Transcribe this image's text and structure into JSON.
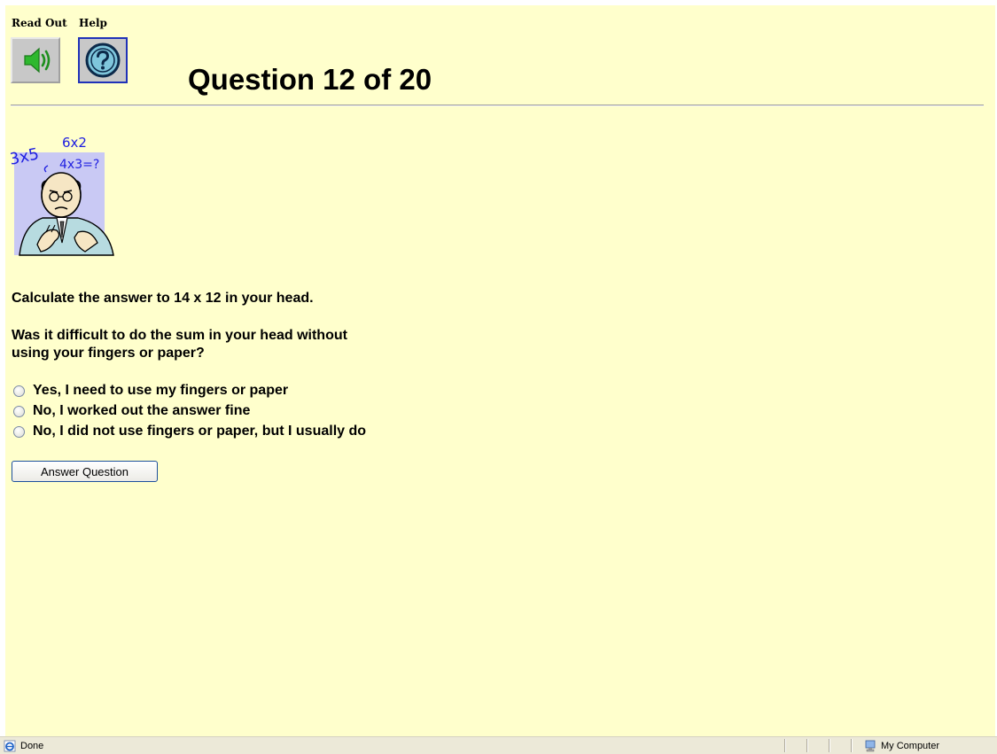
{
  "toolbar": {
    "read_out_label": "Read Out",
    "help_label": "Help",
    "read_out_icon": "speaker-icon",
    "help_icon": "question-mark-icon"
  },
  "header": {
    "title": "Question 12 of 20"
  },
  "illustration": {
    "icon": "thinking-man-math-icon",
    "math_text": [
      "3x5",
      "6x2",
      "4x3=?"
    ]
  },
  "question": {
    "instruction": "Calculate the answer to 14 x 12 in your head.",
    "prompt_line1": "Was it difficult to do the sum in your head without",
    "prompt_line2": "using your fingers or paper?",
    "options": [
      "Yes, I need to use my fingers or paper",
      "No, I worked out the answer fine",
      "No, I did not use fingers or paper, but I usually do"
    ],
    "submit_label": "Answer Question"
  },
  "statusbar": {
    "status_text": "Done",
    "zone_text": "My Computer"
  },
  "colors": {
    "page_background": "#ffffcc",
    "help_border": "#2032b8"
  }
}
